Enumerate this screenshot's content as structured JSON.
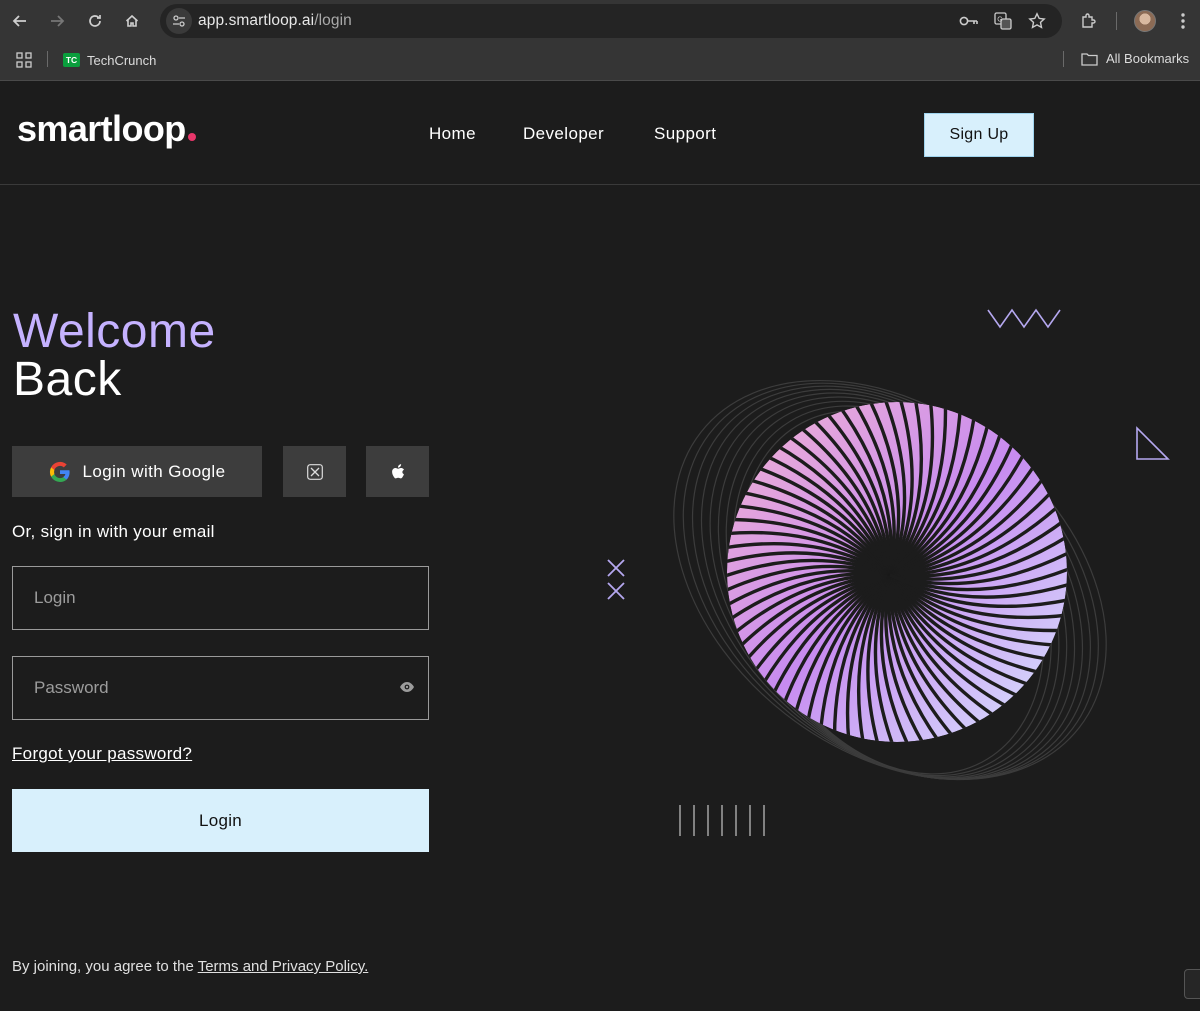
{
  "browser": {
    "url_host": "app.smartloop.ai",
    "url_path": "/login",
    "bookmarks": [
      {
        "label": "TechCrunch",
        "icon": "techcrunch-icon"
      }
    ],
    "all_bookmarks_label": "All Bookmarks",
    "techcrunch_logo_text": "TC"
  },
  "site": {
    "logo_text": "smartloop",
    "nav": [
      {
        "label": "Home"
      },
      {
        "label": "Developer"
      },
      {
        "label": "Support"
      }
    ],
    "signup_label": "Sign Up"
  },
  "login": {
    "heading_line1": "Welcome",
    "heading_line2": "Back",
    "google_label": "Login with Google",
    "or_text": "Or, sign in with your email",
    "login_placeholder": "Login",
    "password_placeholder": "Password",
    "forgot_label": "Forgot your password?",
    "submit_label": "Login",
    "terms_prefix": "By joining, you agree to the ",
    "terms_link": "Terms and Privacy Policy."
  },
  "colors": {
    "background": "#1c1c1c",
    "accent_lavender": "#c5b2ff",
    "button_light_blue": "#d8f0fc",
    "logo_dot_pink": "#e8366a",
    "social_button_bg": "#3d3d3d"
  }
}
